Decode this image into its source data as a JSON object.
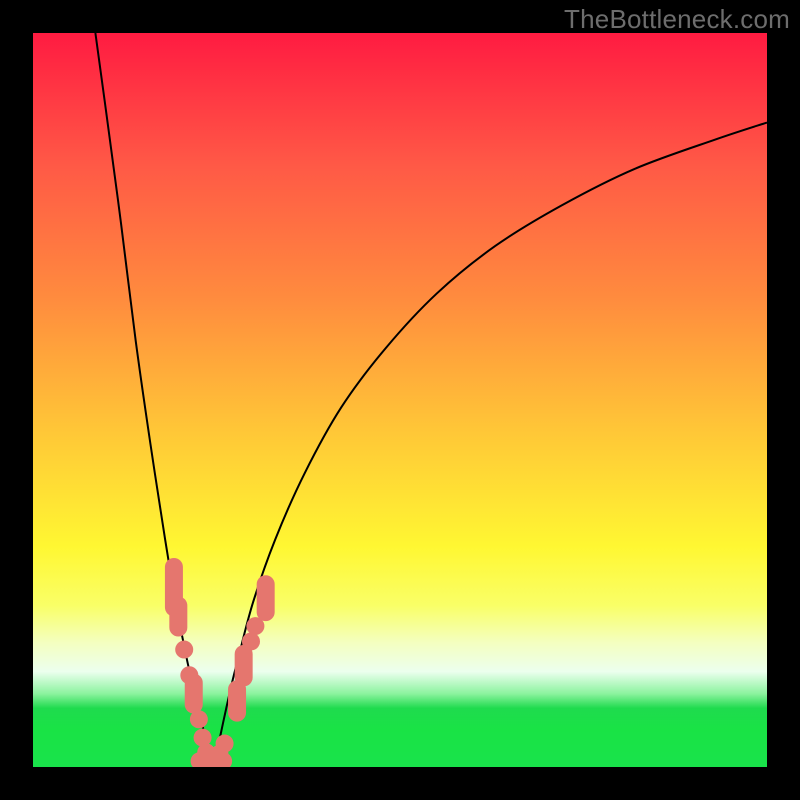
{
  "watermark": "TheBottleneck.com",
  "colors": {
    "frame": "#000000",
    "curve_stroke": "#000000",
    "marker_fill": "#e5766e",
    "gradient_top": "#ff1b41",
    "gradient_bottom": "#19e34b"
  },
  "chart_data": {
    "type": "line",
    "title": "",
    "xlabel": "",
    "ylabel": "",
    "xlim": [
      0,
      100
    ],
    "ylim": [
      0,
      100
    ],
    "series": [
      {
        "name": "left-branch",
        "x": [
          8.5,
          10,
          12,
          14,
          16,
          18,
          19,
          20,
          21,
          22,
          23,
          23.8,
          24.3
        ],
        "y": [
          100,
          89,
          74,
          58,
          44,
          31,
          25,
          19.5,
          14.5,
          10,
          6,
          2.5,
          0.5
        ]
      },
      {
        "name": "right-branch",
        "x": [
          24.3,
          25,
          26,
          27,
          28,
          30,
          33,
          37,
          42,
          48,
          55,
          63,
          72,
          82,
          93,
          100
        ],
        "y": [
          0.5,
          2,
          6.5,
          11,
          15,
          22.5,
          31,
          40,
          49,
          57,
          64.5,
          71,
          76.5,
          81.5,
          85.5,
          87.8
        ]
      }
    ],
    "markers": {
      "name": "highlighted-points",
      "points": [
        {
          "x": 19.2,
          "y": 24.5,
          "shape": "pill-v",
          "len": 5.5
        },
        {
          "x": 19.8,
          "y": 20.5,
          "shape": "pill-v",
          "len": 3.0
        },
        {
          "x": 20.6,
          "y": 16.0,
          "shape": "dot"
        },
        {
          "x": 21.3,
          "y": 12.5,
          "shape": "dot"
        },
        {
          "x": 21.9,
          "y": 10.0,
          "shape": "pill-v",
          "len": 3.0
        },
        {
          "x": 22.6,
          "y": 6.5,
          "shape": "dot"
        },
        {
          "x": 23.1,
          "y": 4.0,
          "shape": "dot"
        },
        {
          "x": 23.6,
          "y": 2.0,
          "shape": "dot"
        },
        {
          "x": 24.3,
          "y": 0.8,
          "shape": "pill-h",
          "len": 3.2
        },
        {
          "x": 25.4,
          "y": 1.8,
          "shape": "dot"
        },
        {
          "x": 26.1,
          "y": 3.2,
          "shape": "dot"
        },
        {
          "x": 27.8,
          "y": 9.0,
          "shape": "pill-v",
          "len": 3.2
        },
        {
          "x": 28.7,
          "y": 13.8,
          "shape": "pill-v",
          "len": 3.2
        },
        {
          "x": 29.7,
          "y": 17.1,
          "shape": "dot"
        },
        {
          "x": 30.3,
          "y": 19.2,
          "shape": "dot"
        },
        {
          "x": 31.7,
          "y": 23.0,
          "shape": "pill-v",
          "len": 3.8
        }
      ]
    }
  }
}
